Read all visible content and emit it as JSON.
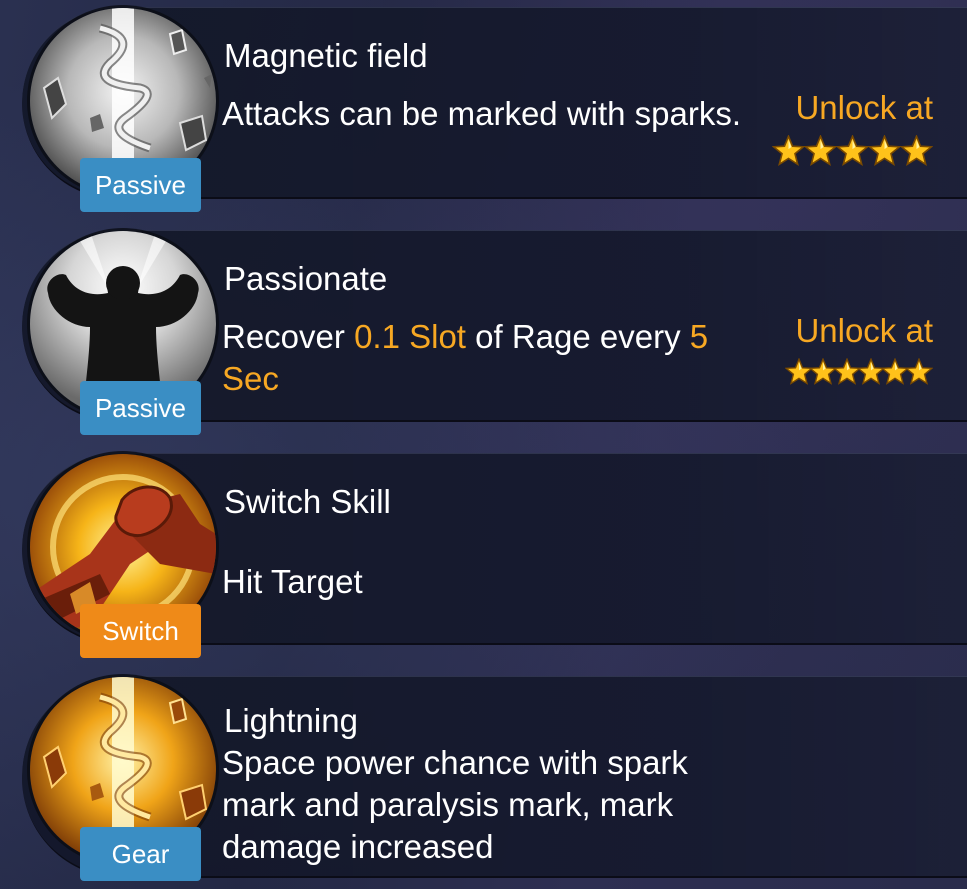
{
  "skills": [
    {
      "name": "Magnetic field",
      "badge": "Passive",
      "badge_color": "#3a8ec4",
      "icon": "lightning-bolt-icon",
      "desc_parts": [
        "Attacks can be marked with sparks."
      ],
      "unlock_label": "Unlock at",
      "stars": 5
    },
    {
      "name": "Passionate",
      "badge": "Passive",
      "badge_color": "#3a8ec4",
      "icon": "flexing-silhouette-icon",
      "desc_parts": [
        "Recover ",
        "0.1 Slot",
        " of Rage every ",
        "5 Sec"
      ],
      "unlock_label": "Unlock at",
      "stars": 6
    },
    {
      "name": "Switch Skill",
      "badge": "Switch",
      "badge_color": "#ef8a18",
      "icon": "handshake-icon",
      "desc_parts": [
        "Hit Target"
      ]
    },
    {
      "name": "Lightning",
      "badge": "Gear",
      "badge_color": "#3a8ec4",
      "icon": "golden-lightning-icon",
      "desc_parts": [
        "Space power chance with spark mark and paralysis mark, mark damage increased"
      ]
    }
  ],
  "colors": {
    "highlight": "#f7a823",
    "passive_badge": "#3a8ec4",
    "switch_badge": "#ef8a18"
  }
}
